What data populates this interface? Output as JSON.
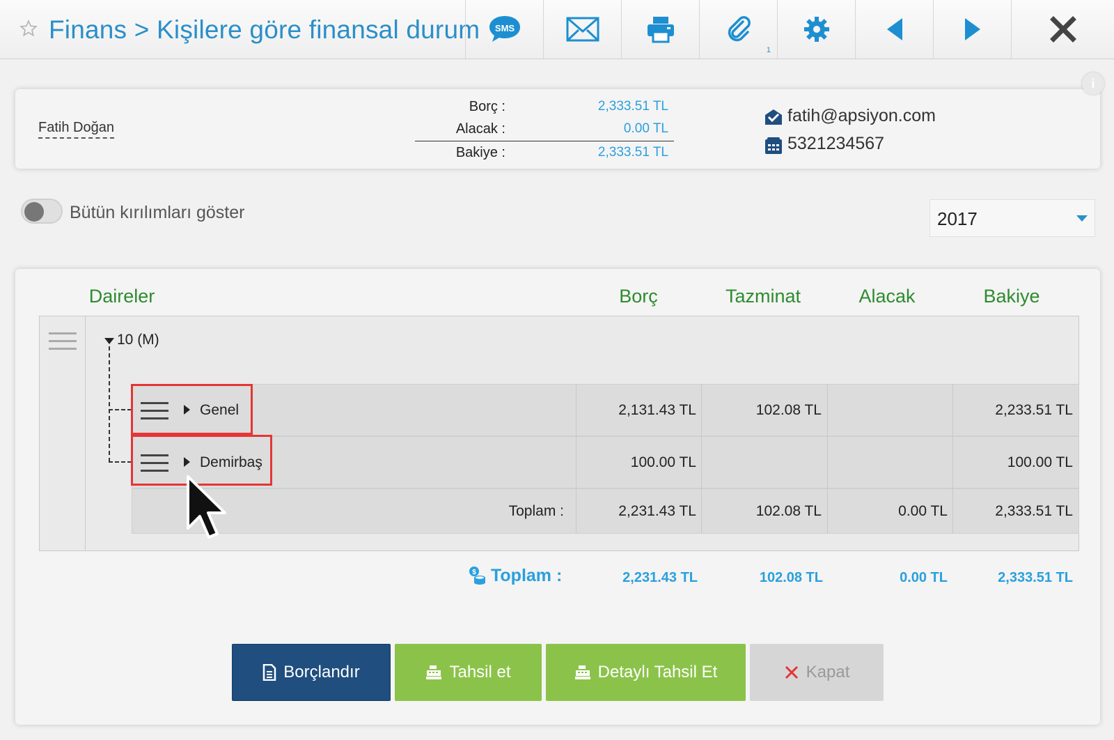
{
  "header": {
    "title": "Finans > Kişilere göre finansal durum",
    "toolbar": [
      {
        "icon": "sms-icon"
      },
      {
        "icon": "mail-icon"
      },
      {
        "icon": "print-icon"
      },
      {
        "icon": "paperclip-icon",
        "badge": "1"
      },
      {
        "icon": "gear-icon"
      },
      {
        "icon": "prev-icon"
      },
      {
        "icon": "next-icon"
      },
      {
        "icon": "close-icon"
      }
    ]
  },
  "person": {
    "name": "Fatih Doğan",
    "borc_label": "Borç :",
    "borc_value": "2,333.51 TL",
    "alacak_label": "Alacak :",
    "alacak_value": "0.00 TL",
    "bakiye_label": "Bakiye :",
    "bakiye_value": "2,333.51 TL",
    "email": "fatih@apsiyon.com",
    "phone": "5321234567"
  },
  "filters": {
    "toggle_label": "Bütün kırılımları göster",
    "toggle_on": false,
    "year": "2017"
  },
  "table": {
    "headers": {
      "daireler": "Daireler",
      "borc": "Borç",
      "tazminat": "Tazminat",
      "alacak": "Alacak",
      "bakiye": "Bakiye"
    },
    "root": "10 (M)",
    "rows": [
      {
        "label": "Genel",
        "borc": "2,131.43 TL",
        "tazminat": "102.08 TL",
        "alacak": "",
        "bakiye": "2,233.51 TL"
      },
      {
        "label": "Demirbaş",
        "borc": "100.00 TL",
        "tazminat": "",
        "alacak": "",
        "bakiye": "100.00 TL"
      }
    ],
    "subtotal": {
      "label": "Toplam :",
      "borc": "2,231.43 TL",
      "tazminat": "102.08 TL",
      "alacak": "0.00 TL",
      "bakiye": "2,333.51 TL"
    },
    "grand_total": {
      "label": "Toplam :",
      "borc": "2,231.43 TL",
      "tazminat": "102.08 TL",
      "alacak": "0.00 TL",
      "bakiye": "2,333.51 TL"
    }
  },
  "buttons": {
    "borclandir": "Borçlandır",
    "tahsil_et": "Tahsil et",
    "detayli_tahsil_et": "Detaylı Tahsil Et",
    "kapat": "Kapat"
  },
  "colors": {
    "accent_blue": "#2a8fc9",
    "value_blue": "#2aa0de",
    "header_green": "#2e8b2e",
    "button_navy": "#1f4e7f",
    "button_green": "#8bc34a",
    "highlight_red": "#e53535"
  }
}
